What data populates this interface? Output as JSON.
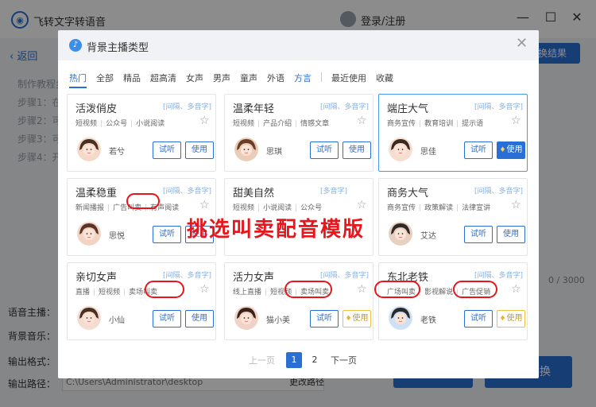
{
  "app": {
    "title": "飞转文字转语音",
    "login": "登录/注册",
    "back": "返回",
    "steps": [
      "制作教程步",
      "步骤1：在",
      "步骤2：可",
      "步骤3：可",
      "步骤4：开"
    ],
    "right_button": "换结果",
    "counter": "0 / 3000",
    "labels": {
      "voice": "语音主播：",
      "bgm": "背景音乐：",
      "format": "输出格式：",
      "path": "输出路径："
    },
    "path_value": "C:\\Users\\Administrator\\desktop",
    "change_path": "更改路径",
    "convert": "开始转换"
  },
  "modal": {
    "title": "背景主播类型",
    "tabs": [
      "热门",
      "全部",
      "精品",
      "超高清",
      "女声",
      "男声",
      "童声",
      "外语",
      "方言"
    ],
    "tabs_extra": [
      "最近使用",
      "收藏"
    ],
    "overlay_text": "挑选叫卖配音模版",
    "listen_label": "试听",
    "use_label": "使用",
    "cards": [
      {
        "name": "活泼俏皮",
        "tag": "[间隔、多音字]",
        "cats": [
          "短视频",
          "公众号",
          "小说阅读"
        ],
        "voice": "若兮",
        "use": "plain"
      },
      {
        "name": "温柔年轻",
        "tag": "[间隔、多音字]",
        "cats": [
          "短视频",
          "产品介绍",
          "情感文章"
        ],
        "voice": "思琪",
        "use": "plain"
      },
      {
        "name": "端庄大气",
        "tag": "[间隔、多音字]",
        "cats": [
          "商务宣传",
          "教育培训",
          "提示语"
        ],
        "voice": "思佳",
        "use": "primary"
      },
      {
        "name": "温柔稳重",
        "tag": "[间隔、多音字]",
        "cats": [
          "新闻播报",
          "广告叫卖",
          "有声阅读"
        ],
        "voice": "思悦",
        "use": "plain"
      },
      {
        "name": "甜美自然",
        "tag": "[多音字]",
        "cats": [
          "短视频",
          "小说阅读",
          "公众号"
        ],
        "voice": "",
        "use": "none"
      },
      {
        "name": "商务大气",
        "tag": "[间隔、多音字]",
        "cats": [
          "商务宣传",
          "政策解读",
          "法律宣讲"
        ],
        "voice": "艾达",
        "use": "plain"
      },
      {
        "name": "亲切女声",
        "tag": "[间隔、多音字]",
        "cats": [
          "直播",
          "短视频",
          "卖场叫卖"
        ],
        "voice": "小仙",
        "use": "plain"
      },
      {
        "name": "活力女声",
        "tag": "[间隔、多音字]",
        "cats": [
          "线上直播",
          "短视频",
          "卖场叫卖"
        ],
        "voice": "猫小美",
        "use": "vip"
      },
      {
        "name": "东北老铁",
        "tag": "[间隔、多音字]",
        "cats": [
          "广场叫卖",
          "影视解说",
          "广告促销"
        ],
        "voice": "老铁",
        "use": "vip"
      }
    ],
    "pager": {
      "prev": "上一页",
      "pages": [
        "1",
        "2"
      ],
      "next": "下一页"
    }
  },
  "colors": {
    "accent": "#2a6fd6",
    "highlight": "#e6161c",
    "vip": "#f0b020"
  }
}
